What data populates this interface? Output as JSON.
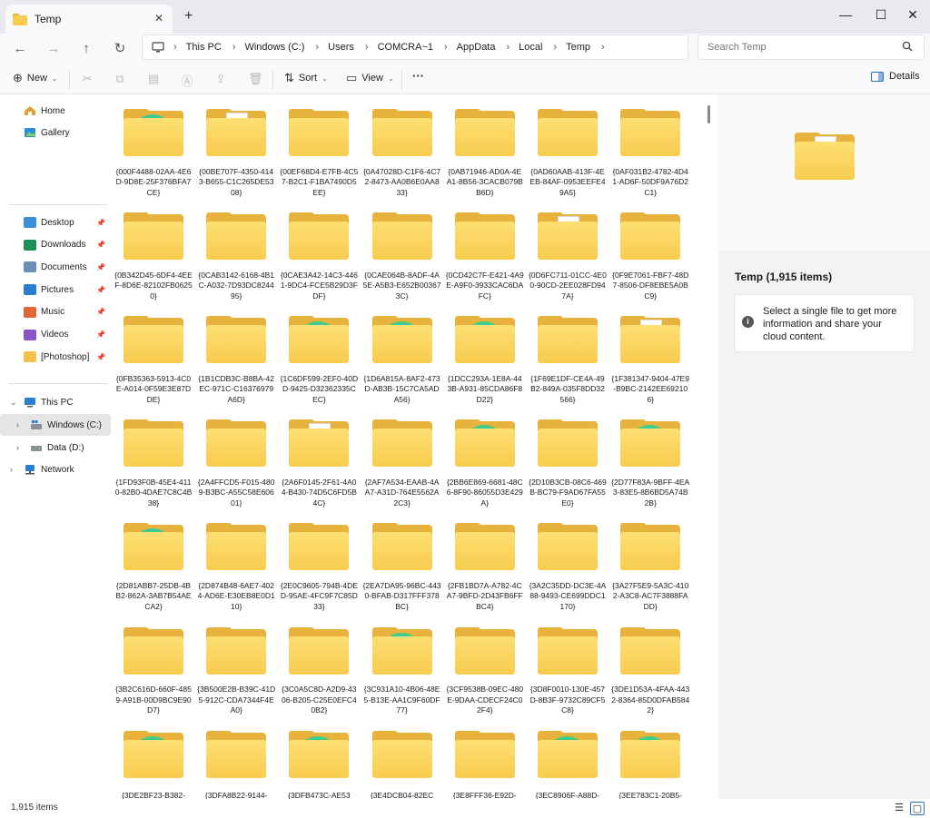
{
  "window": {
    "tab_title": "Temp",
    "new_tab_symbol": "+",
    "minimize_symbol": "—",
    "maximize_symbol": "☐",
    "close_symbol": "✕",
    "tab_close_symbol": "✕"
  },
  "nav": {
    "back_symbol": "←",
    "forward_symbol": "→",
    "up_symbol": "↑",
    "refresh_symbol": "↻",
    "breadcrumbs": [
      "This PC",
      "Windows (C:)",
      "Users",
      "COMCRA~1",
      "AppData",
      "Local",
      "Temp"
    ],
    "search_placeholder": "Search Temp"
  },
  "commands": {
    "new_label": "New",
    "sort_label": "Sort",
    "view_label": "View",
    "more_label": "···",
    "details_label": "Details"
  },
  "sidebar": {
    "home": "Home",
    "gallery": "Gallery",
    "pinned": [
      {
        "label": "Desktop",
        "icon": "desktop-icon",
        "color": "#3a8fd8"
      },
      {
        "label": "Downloads",
        "icon": "downloads-icon",
        "color": "#1b8f57"
      },
      {
        "label": "Documents",
        "icon": "documents-icon",
        "color": "#6b8fb5"
      },
      {
        "label": "Pictures",
        "icon": "pictures-icon",
        "color": "#2a7fd0"
      },
      {
        "label": "Music",
        "icon": "music-icon",
        "color": "#e0663a"
      },
      {
        "label": "Videos",
        "icon": "videos-icon",
        "color": "#8a55c7"
      },
      {
        "label": "[Photoshop]",
        "icon": "folder-icon",
        "color": "#f2c24b"
      }
    ],
    "this_pc": "This PC",
    "drives": [
      {
        "label": "Windows (C:)",
        "selected": true
      },
      {
        "label": "Data (D:)",
        "selected": false
      }
    ],
    "network": "Network"
  },
  "folders": [
    {
      "name": "{000F4488-02AA-4E6D-9D8E-25F376BFA7CE}",
      "overlay": "edge"
    },
    {
      "name": "{00BE707F-4350-4143-B655-C1C265DE5308}",
      "overlay": "paper"
    },
    {
      "name": "{00EF68D4-E7FB-4C57-B2C1-F1BA7490D5EE}",
      "overlay": "none"
    },
    {
      "name": "{0A47028D-C1F6-4C72-8473-AA0B6E0AA833}",
      "overlay": "none"
    },
    {
      "name": "{0AB71946-AD0A-4EA1-8B56-3CACB079BB6D}",
      "overlay": "none"
    },
    {
      "name": "{0AD60AAB-413F-4EEB-84AF-0953EEFE49A5}",
      "overlay": "none"
    },
    {
      "name": "{0AF031B2-4782-4D41-AD6F-50DF9A76D2C1}",
      "overlay": "none"
    },
    {
      "name": "{0B342D45-6DF4-4EEF-8D6E-82102FB06250}",
      "overlay": "none"
    },
    {
      "name": "{0CAB3142-6168-4B1C-A032-7D93DC824495}",
      "overlay": "none"
    },
    {
      "name": "{0CAE3A42-14C3-4461-9DC4-FCE5B29D3FDF}",
      "overlay": "none"
    },
    {
      "name": "{0CAE064B-8ADF-4A5E-A5B3-E652B003673C}",
      "overlay": "none"
    },
    {
      "name": "{0CD42C7F-E421-4A9E-A9F0-3933CAC6DAFC}",
      "overlay": "none"
    },
    {
      "name": "{0D6FC711-01CC-4E00-90CD-2EE028FD947A}",
      "overlay": "paper"
    },
    {
      "name": "{0F9E7061-FBF7-48D7-8506-DF8EBE5A0BC9}",
      "overlay": "none"
    },
    {
      "name": "{0FB35363-5913-4C0E-A014-0F59E3E87DDE}",
      "overlay": "none"
    },
    {
      "name": "{1B1CDB3C-B8BA-42EC-971C-C16376979A6D}",
      "overlay": "none"
    },
    {
      "name": "{1C6DF599-2EF0-40DD-9425-D32362335CEC}",
      "overlay": "edge"
    },
    {
      "name": "{1D6A815A-8AF2-473D-AB3B-15C7CA5ADA56}",
      "overlay": "edge"
    },
    {
      "name": "{1DCC293A-1E8A-443B-A931-85CDA86F8D22}",
      "overlay": "edge"
    },
    {
      "name": "{1F69E1DF-CE4A-49B2-849A-035F8DD32566}",
      "overlay": "none"
    },
    {
      "name": "{1F381347-9404-47E9-B9BC-2142EE692106}",
      "overlay": "paper"
    },
    {
      "name": "{1FD93F0B-45E4-4110-82B0-4DAE7C8C4B38}",
      "overlay": "none"
    },
    {
      "name": "{2A4FFCD5-F015-4809-B3BC-A55C58E60601}",
      "overlay": "none"
    },
    {
      "name": "{2A6F0145-2F61-4A04-B430-74D5C6FD5B4C}",
      "overlay": "paper"
    },
    {
      "name": "{2AF7A534-EAAB-4AA7-A31D-764E5562A2C3}",
      "overlay": "none"
    },
    {
      "name": "{2BB6E869-6681-48C6-8F90-86055D3E429A}",
      "overlay": "edge"
    },
    {
      "name": "{2D10B3CB-08C6-469B-BC79-F9AD67FA55E0}",
      "overlay": "none"
    },
    {
      "name": "{2D77F83A-9BFF-4EA3-83E5-8B6BD5A74B2B}",
      "overlay": "edge"
    },
    {
      "name": "{2D81ABB7-25DB-4BB2-862A-3AB7B54AECA2}",
      "overlay": "edge"
    },
    {
      "name": "{2D874B48-6AE7-4024-AD6E-E30EB8E0D110}",
      "overlay": "none"
    },
    {
      "name": "{2E0C9605-794B-4DED-95AE-4FC9F7C85D33}",
      "overlay": "none"
    },
    {
      "name": "{2EA7DA95-96BC-4430-BFAB-D317FFF378BC}",
      "overlay": "none"
    },
    {
      "name": "{2FB1BD7A-A782-4CA7-9BFD-2D43FB6FFBC4}",
      "overlay": "none"
    },
    {
      "name": "{3A2C35DD-DC3E-4A88-9493-CE699DDC1170}",
      "overlay": "none"
    },
    {
      "name": "{3A27F5E9-5A3C-4102-A3C8-AC7F3888FADD}",
      "overlay": "none"
    },
    {
      "name": "{3B2C616D-660F-4859-A91B-00D9BC9E90D7}",
      "overlay": "none"
    },
    {
      "name": "{3B500E2B-B39C-41D5-912C-CDA7344F4EA0}",
      "overlay": "none"
    },
    {
      "name": "{3C0A5C8D-A2D9-4306-B205-C25E0EFC40B2}",
      "overlay": "none"
    },
    {
      "name": "{3C931A10-4B06-48E5-B13E-AA1C9F60DF77}",
      "overlay": "edge"
    },
    {
      "name": "{3CF9538B-09EC-480E-9DAA-CDECF24C02F4}",
      "overlay": "none"
    },
    {
      "name": "{3D8F0010-130E-457D-8B3F-9732C89CF5C8}",
      "overlay": "none"
    },
    {
      "name": "{3DE1D53A-4FAA-4432-8364-85D0DFAB5842}",
      "overlay": "none"
    },
    {
      "name": "{3DE2BF23-B382-",
      "overlay": "edge"
    },
    {
      "name": "{3DFA8B22-9144-",
      "overlay": "none"
    },
    {
      "name": "{3DFB473C-AE53",
      "overlay": "edge"
    },
    {
      "name": "{3E4DCB04-82EC",
      "overlay": "none"
    },
    {
      "name": "{3E8FFF36-E92D-",
      "overlay": "none"
    },
    {
      "name": "{3EC8906F-A88D-",
      "overlay": "edge"
    },
    {
      "name": "{3EE783C1-20B5-",
      "overlay": "edge"
    }
  ],
  "details": {
    "title": "Temp (1,915 items)",
    "message": "Select a single file to get more information and share your cloud content.",
    "info_symbol": "i"
  },
  "status": {
    "item_count": "1,915 items"
  },
  "colors": {
    "folder_yellow": "#f8cc4e",
    "folder_back": "#e8b33c",
    "selected_bg": "#e5e5e5",
    "details_bg": "#f3f3f3"
  }
}
